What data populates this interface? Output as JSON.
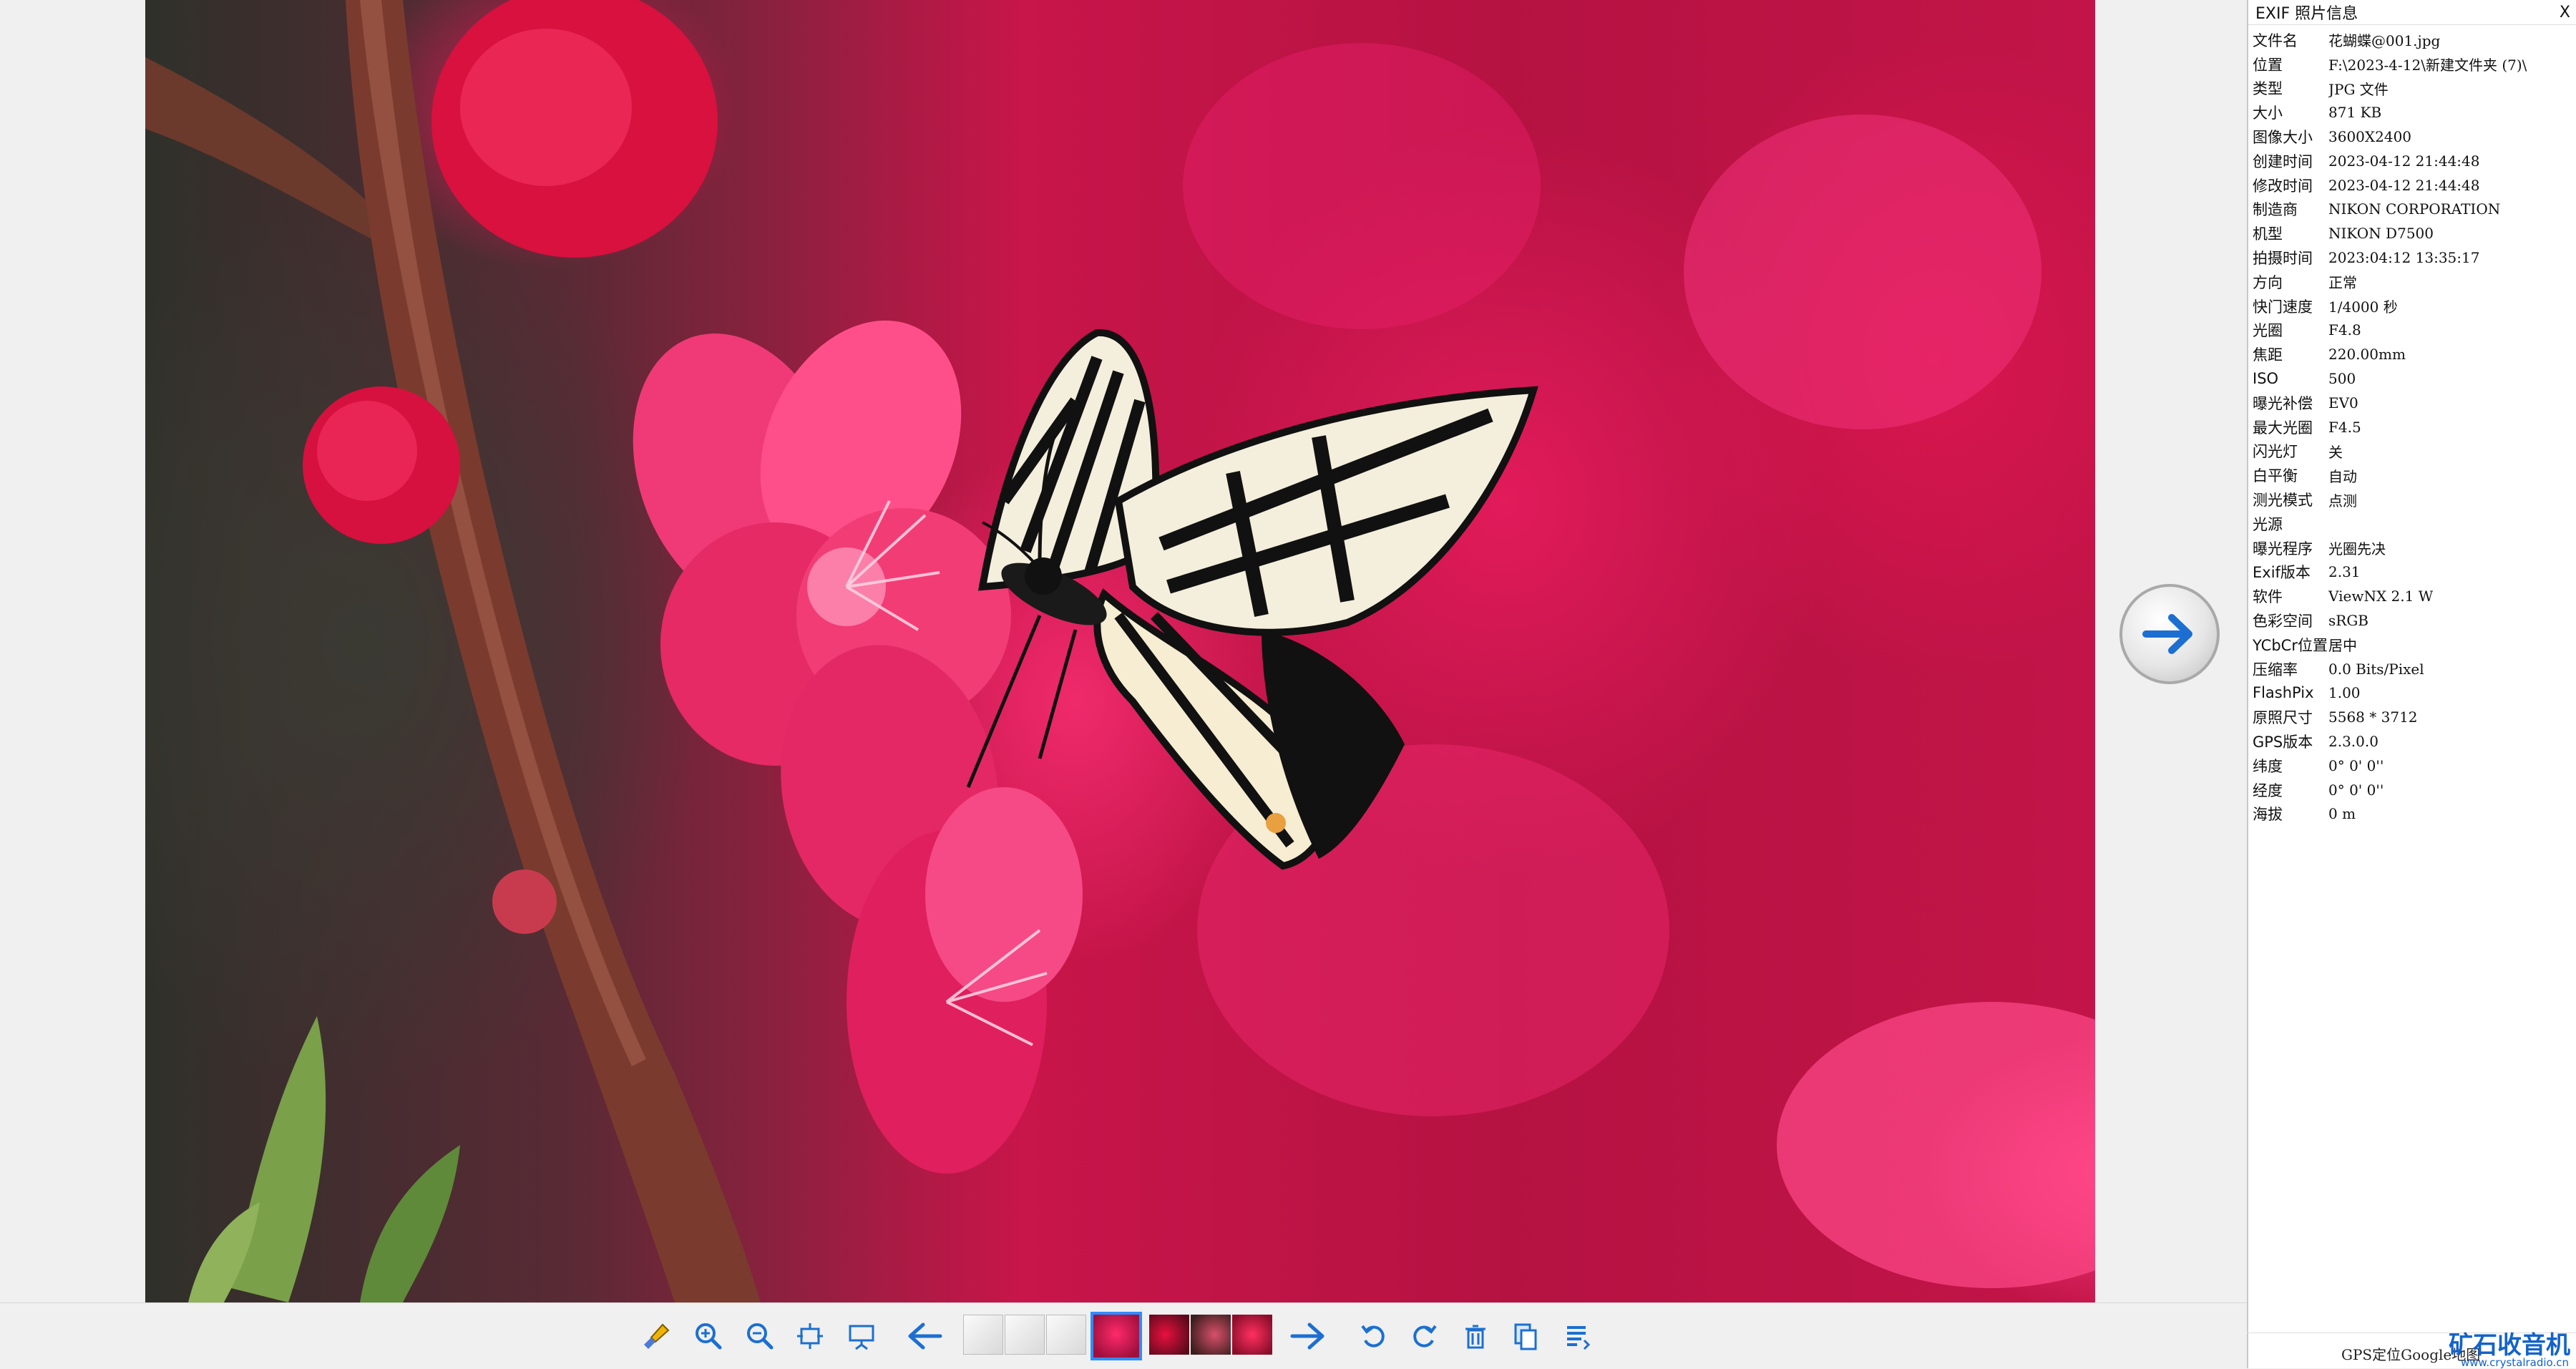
{
  "exif": {
    "title": "EXIF 照片信息",
    "close_label": "X",
    "rows": [
      {
        "k": "文件名",
        "v": "花蝴蝶@001.jpg"
      },
      {
        "k": "位置",
        "v": "F:\\2023-4-12\\新建文件夹 (7)\\"
      },
      {
        "k": "类型",
        "v": "JPG 文件"
      },
      {
        "k": "大小",
        "v": "871 KB"
      },
      {
        "k": "图像大小",
        "v": "3600X2400"
      },
      {
        "k": "创建时间",
        "v": "2023-04-12 21:44:48"
      },
      {
        "k": "修改时间",
        "v": "2023-04-12 21:44:48"
      },
      {
        "k": "制造商",
        "v": "NIKON CORPORATION"
      },
      {
        "k": "机型",
        "v": "NIKON D7500"
      },
      {
        "k": "拍摄时间",
        "v": "2023:04:12 13:35:17"
      },
      {
        "k": "方向",
        "v": "正常"
      },
      {
        "k": "快门速度",
        "v": "1/4000 秒"
      },
      {
        "k": "光圈",
        "v": "F4.8"
      },
      {
        "k": "焦距",
        "v": "220.00mm"
      },
      {
        "k": "ISO",
        "v": "500"
      },
      {
        "k": "曝光补偿",
        "v": "EV0"
      },
      {
        "k": "最大光圈",
        "v": "F4.5"
      },
      {
        "k": "闪光灯",
        "v": "关"
      },
      {
        "k": "白平衡",
        "v": "自动"
      },
      {
        "k": "测光模式",
        "v": "点测"
      },
      {
        "k": "光源",
        "v": ""
      },
      {
        "k": "曝光程序",
        "v": "光圈先决"
      },
      {
        "k": "Exif版本",
        "v": "2.31"
      },
      {
        "k": "软件",
        "v": "ViewNX 2.1 W"
      },
      {
        "k": "色彩空间",
        "v": "sRGB"
      },
      {
        "k": "YCbCr位置",
        "v": "居中"
      },
      {
        "k": "压缩率",
        "v": "0.0 Bits/Pixel"
      },
      {
        "k": "FlashPix",
        "v": "1.00"
      },
      {
        "k": "原照尺寸",
        "v": "5568 * 3712"
      },
      {
        "k": "GPS版本",
        "v": "2.3.0.0"
      },
      {
        "k": "纬度",
        "v": "0° 0' 0''"
      },
      {
        "k": "经度",
        "v": "0° 0' 0''"
      },
      {
        "k": "海拔",
        "v": "0 m"
      }
    ]
  },
  "footer": {
    "gps_label": "GPS定位Google地图",
    "logo": "矿石收音机",
    "logo_url": "www.crystalradio.cn"
  },
  "icons": {
    "next_photo": "arrow-right-circle-icon",
    "toolbar": [
      "brush-icon",
      "zoom-in-icon",
      "zoom-out-icon",
      "fit-icon",
      "slideshow-icon",
      "arrow-left-icon",
      "arrow-right-icon",
      "rotate-left-icon",
      "rotate-right-icon",
      "delete-icon",
      "copy-icon",
      "info-icon"
    ]
  },
  "colors": {
    "accent": "#1c6fd1",
    "selection": "#2f8cff"
  }
}
